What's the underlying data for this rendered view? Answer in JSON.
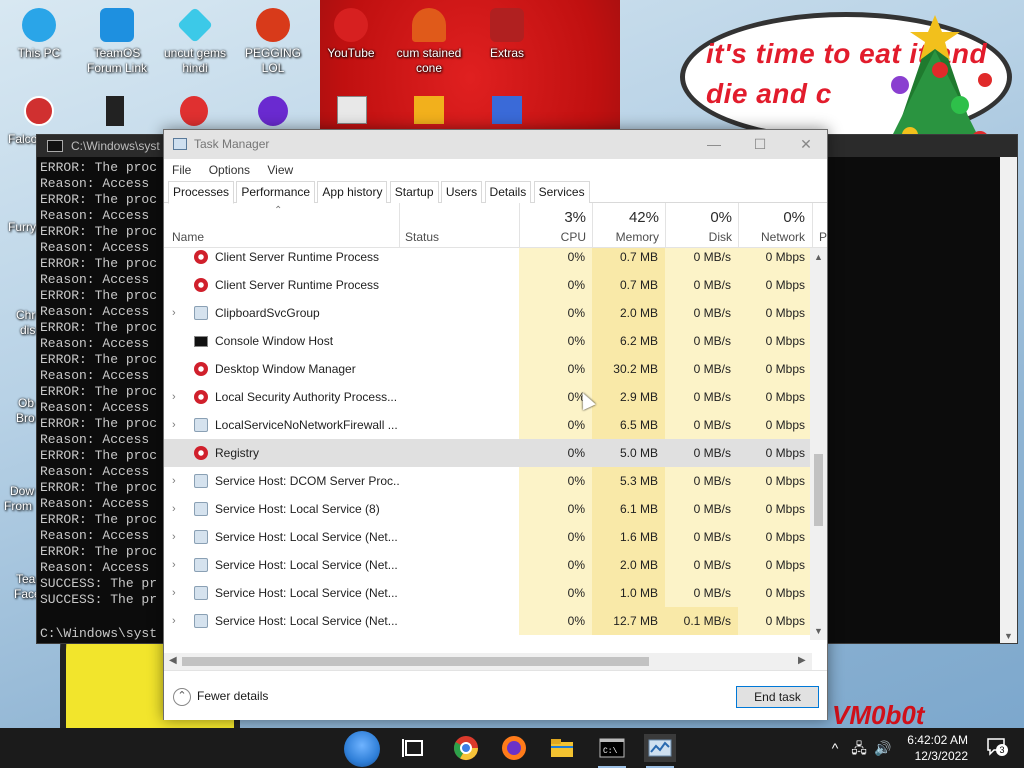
{
  "desktop": {
    "icons_row1": [
      {
        "label": "This PC",
        "icon": "this-pc-icon",
        "color": "#2aa5e8"
      },
      {
        "label": "TeamOS Forum Link",
        "icon": "gear-link-icon",
        "color": "#1e90e0"
      },
      {
        "label": "uncut gems hindi",
        "icon": "gem-icon",
        "color": "#3cc9e8"
      },
      {
        "label": "PEGGING LOL",
        "icon": "p-badge-icon",
        "color": "#d83a1a"
      },
      {
        "label": "YouTube",
        "icon": "angry-bird-icon",
        "color": "#d72020"
      },
      {
        "label": "cum stained cone",
        "icon": "ice-cream-icon",
        "color": "#e05a1a"
      },
      {
        "label": "Extras",
        "icon": "winrar-icon",
        "color": "#b02020"
      }
    ],
    "partial_left_labels": [
      "Falco",
      "Furry",
      "Chr",
      "dis",
      "Ob",
      "Bro",
      "Dow",
      "From",
      "Tea",
      "Face"
    ],
    "speech_text": "it's time to eat it and die and c",
    "watermark": "VM0b0t"
  },
  "console": {
    "title": "C:\\Windows\\syst",
    "lines": [
      "ERROR: The proc",
      "Reason: Access",
      "ERROR: The proc",
      "Reason: Access",
      "ERROR: The proc",
      "Reason: Access",
      "ERROR: The proc",
      "Reason: Access",
      "ERROR: The proc",
      "Reason: Access",
      "ERROR: The proc",
      "Reason: Access",
      "ERROR: The proc",
      "Reason: Access",
      "ERROR: The proc",
      "Reason: Access",
      "ERROR: The proc",
      "Reason: Access",
      "ERROR: The proc",
      "Reason: Access",
      "ERROR: The proc",
      "Reason: Access",
      "ERROR: The proc",
      "Reason: Access",
      "ERROR: The proc",
      "Reason: Access",
      "SUCCESS: The pr",
      "SUCCESS: The pr"
    ],
    "prompt": "C:\\Windows\\syst"
  },
  "taskmanager": {
    "title": "Task Manager",
    "window_buttons": {
      "minimize": "—",
      "maximize": "☐",
      "close": "✕"
    },
    "menu": [
      "File",
      "Options",
      "View"
    ],
    "tabs": [
      "Processes",
      "Performance",
      "App history",
      "Startup",
      "Users",
      "Details",
      "Services"
    ],
    "active_tab": "Processes",
    "columns": {
      "name": "Name",
      "status": "Status",
      "cpu": {
        "label": "CPU",
        "pct": "3%"
      },
      "memory": {
        "label": "Memory",
        "pct": "42%"
      },
      "disk": {
        "label": "Disk",
        "pct": "0%"
      },
      "network": {
        "label": "Network",
        "pct": "0%"
      },
      "more": "P"
    },
    "rows": [
      {
        "name": "Client Server Runtime Process",
        "icon": "proc",
        "expand": false,
        "cpu": "0%",
        "mem": "0.7 MB",
        "disk": "0 MB/s",
        "net": "0 Mbps"
      },
      {
        "name": "Client Server Runtime Process",
        "icon": "proc",
        "expand": false,
        "cpu": "0%",
        "mem": "0.7 MB",
        "disk": "0 MB/s",
        "net": "0 Mbps"
      },
      {
        "name": "ClipboardSvcGroup",
        "icon": "svc",
        "expand": true,
        "cpu": "0%",
        "mem": "2.0 MB",
        "disk": "0 MB/s",
        "net": "0 Mbps"
      },
      {
        "name": "Console Window Host",
        "icon": "con",
        "expand": false,
        "cpu": "0%",
        "mem": "6.2 MB",
        "disk": "0 MB/s",
        "net": "0 Mbps"
      },
      {
        "name": "Desktop Window Manager",
        "icon": "proc",
        "expand": false,
        "cpu": "0%",
        "mem": "30.2 MB",
        "disk": "0 MB/s",
        "net": "0 Mbps"
      },
      {
        "name": "Local Security Authority Process...",
        "icon": "proc",
        "expand": true,
        "cpu": "0%",
        "mem": "2.9 MB",
        "disk": "0 MB/s",
        "net": "0 Mbps"
      },
      {
        "name": "LocalServiceNoNetworkFirewall ...",
        "icon": "svc",
        "expand": true,
        "cpu": "0%",
        "mem": "6.5 MB",
        "disk": "0 MB/s",
        "net": "0 Mbps"
      },
      {
        "name": "Registry",
        "icon": "proc",
        "expand": false,
        "selected": true,
        "cpu": "0%",
        "mem": "5.0 MB",
        "disk": "0 MB/s",
        "net": "0 Mbps"
      },
      {
        "name": "Service Host: DCOM Server Proc...",
        "icon": "svc",
        "expand": true,
        "cpu": "0%",
        "mem": "5.3 MB",
        "disk": "0 MB/s",
        "net": "0 Mbps"
      },
      {
        "name": "Service Host: Local Service (8)",
        "icon": "svc",
        "expand": true,
        "cpu": "0%",
        "mem": "6.1 MB",
        "disk": "0 MB/s",
        "net": "0 Mbps"
      },
      {
        "name": "Service Host: Local Service (Net...",
        "icon": "svc",
        "expand": true,
        "cpu": "0%",
        "mem": "1.6 MB",
        "disk": "0 MB/s",
        "net": "0 Mbps"
      },
      {
        "name": "Service Host: Local Service (Net...",
        "icon": "svc",
        "expand": true,
        "cpu": "0%",
        "mem": "2.0 MB",
        "disk": "0 MB/s",
        "net": "0 Mbps"
      },
      {
        "name": "Service Host: Local Service (Net...",
        "icon": "svc",
        "expand": true,
        "cpu": "0%",
        "mem": "1.0 MB",
        "disk": "0 MB/s",
        "net": "0 Mbps"
      },
      {
        "name": "Service Host: Local Service (Net...",
        "icon": "svc",
        "expand": true,
        "cpu": "0%",
        "mem": "12.7 MB",
        "disk": "0.1 MB/s",
        "disk_hot": true,
        "net": "0 Mbps"
      }
    ],
    "footer": {
      "fewer_details": "Fewer details",
      "end_task": "End task"
    }
  },
  "taskbar": {
    "apps": [
      {
        "icon": "windows-start-orb-icon",
        "color": "#2f7fd8"
      },
      {
        "icon": "task-view-icon",
        "color": "#ffffff"
      },
      {
        "icon": "chrome-icon",
        "color": "#e0322f"
      },
      {
        "icon": "firefox-icon",
        "color": "#ff7b1a"
      },
      {
        "icon": "file-explorer-icon",
        "color": "#f2c230"
      },
      {
        "icon": "command-prompt-icon",
        "color": "#000000"
      },
      {
        "icon": "task-manager-icon",
        "color": "#9ec1e6"
      }
    ],
    "tray": {
      "chevron": "^",
      "network": "🖧",
      "volume": "🔊"
    },
    "time": "6:42:02 AM",
    "date": "12/3/2022",
    "notification_count": "3"
  }
}
